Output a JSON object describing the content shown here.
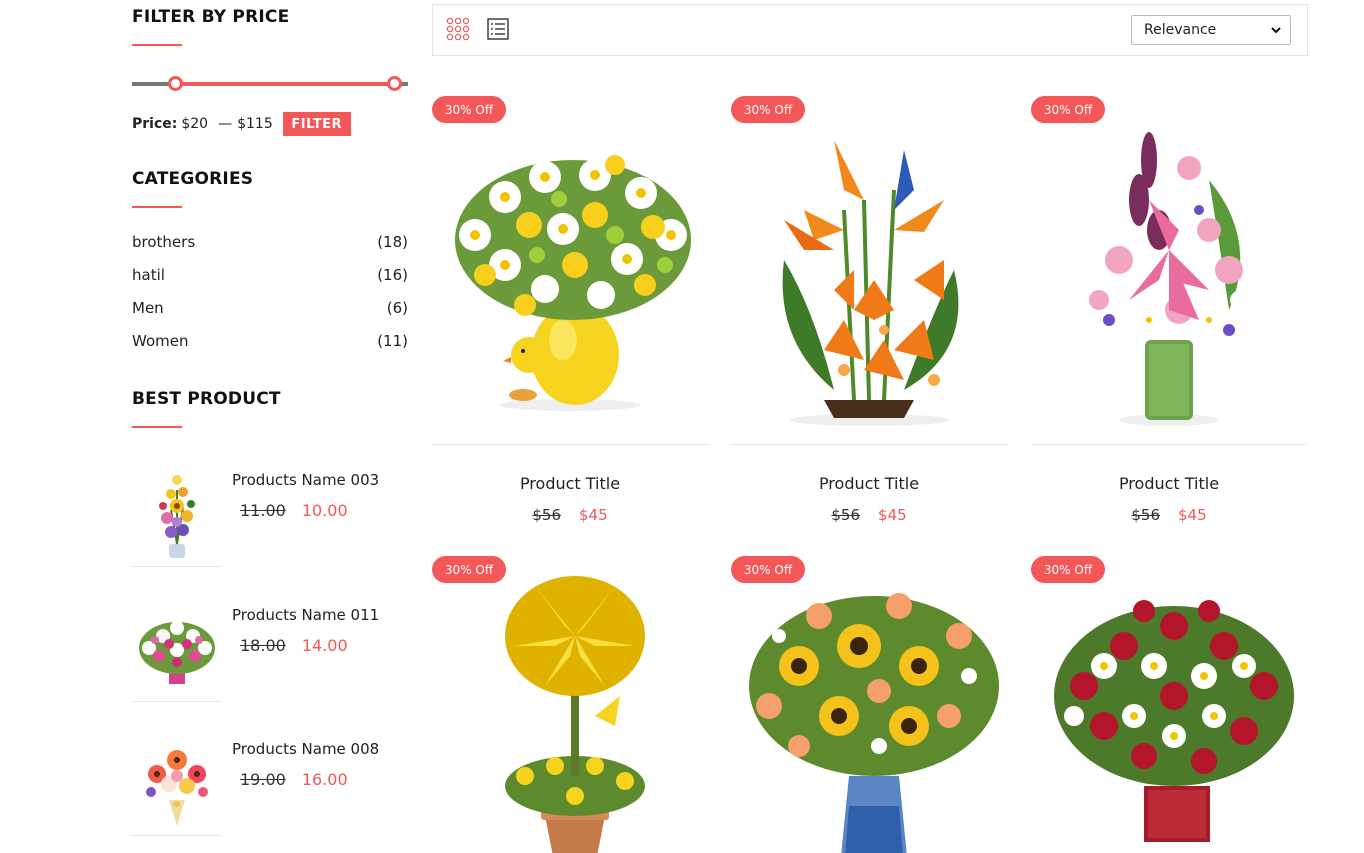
{
  "sidebar": {
    "price_filter": {
      "title": "FILTER BY PRICE",
      "label": "Price:",
      "min": "$20",
      "max": "$115",
      "button": "FILTER"
    },
    "categories": {
      "title": "CATEGORIES",
      "items": [
        {
          "name": "brothers",
          "count": "(18)"
        },
        {
          "name": "hatil",
          "count": "(16)"
        },
        {
          "name": "Men",
          "count": "(6)"
        },
        {
          "name": "Women",
          "count": "(11)"
        }
      ]
    },
    "best_product": {
      "title": "BEST PRODUCT",
      "items": [
        {
          "name": "Products Name 003",
          "old_price": "11.00",
          "new_price": "10.00"
        },
        {
          "name": "Products Name 011",
          "old_price": "18.00",
          "new_price": "14.00"
        },
        {
          "name": "Products Name 008",
          "old_price": "19.00",
          "new_price": "16.00"
        }
      ]
    }
  },
  "toolbar": {
    "sort_value": "Relevance"
  },
  "products": [
    {
      "badge": "30% Off",
      "title": "Product Title",
      "old_price": "$56",
      "new_price": "$45"
    },
    {
      "badge": "30% Off",
      "title": "Product Title",
      "old_price": "$56",
      "new_price": "$45"
    },
    {
      "badge": "30% Off",
      "title": "Product Title",
      "old_price": "$56",
      "new_price": "$45"
    },
    {
      "badge": "30% Off"
    },
    {
      "badge": "30% Off"
    },
    {
      "badge": "30% Off"
    }
  ],
  "colors": {
    "accent": "#f35757",
    "text": "#222222",
    "border": "#e4e4e4"
  }
}
